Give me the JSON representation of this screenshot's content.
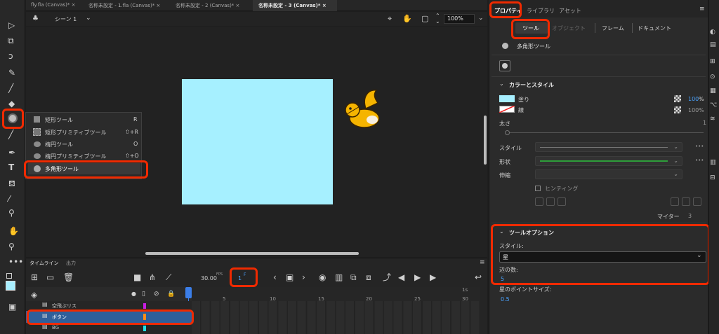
{
  "doc_tabs": [
    "fly.fla (Canvas)*",
    "名称未設定 - 1.fla (Canvas)*",
    "名称未設定 - 2 (Canvas)*",
    "名称未設定 - 3 (Canvas)*"
  ],
  "scene": {
    "name": "シーン 1",
    "zoom": "100%"
  },
  "tool_menu": [
    {
      "label": "矩形ツール",
      "key": "R"
    },
    {
      "label": "矩形プリミティブツール",
      "key": "⇧+R"
    },
    {
      "label": "楕円ツール",
      "key": "O"
    },
    {
      "label": "楕円プリミティブツール",
      "key": "⇧+O"
    },
    {
      "label": "多角形ツール",
      "key": ""
    }
  ],
  "timeline": {
    "tabs": [
      "タイムライン",
      "出力"
    ],
    "fps_value": "30.00",
    "fps_unit": "FPS",
    "frame": "1",
    "frame_unit": "F",
    "ruler": [
      "1s",
      "5",
      "10",
      "15",
      "20",
      "25",
      "30"
    ],
    "layers": [
      "空飛ぶリス",
      "ボタン",
      "BG"
    ]
  },
  "panel": {
    "tabs": [
      "プロパティ",
      "ライブラリ",
      "アセット"
    ],
    "subtabs": [
      "ツール",
      "オブジェクト",
      "フレーム",
      "ドキュメント"
    ],
    "tool_name": "多角形ツール",
    "color_style": {
      "title": "カラーとスタイル",
      "fill_label": "塗り",
      "fill_pct": "100",
      "pct_unit": "%",
      "stroke_label": "線",
      "stroke_pct": "100",
      "width_label": "太さ",
      "width_value": "1",
      "style_label": "スタイル",
      "shape_label": "形状",
      "scale_label": "伸縮",
      "hinting_label": "ヒンティング",
      "miter_label": "マイター",
      "miter_value": "3"
    },
    "tool_options": {
      "title": "ツールオプション",
      "style_label": "スタイル:",
      "style_value": "星",
      "sides_label": "辺の数:",
      "sides_value": "5",
      "point_label": "星のポイントサイズ:",
      "point_value": "0.5"
    }
  },
  "colors": {
    "fill": "#a7efff",
    "stage": "#a6f0ff",
    "highlight": "#f02a00",
    "accent": "#4aa3ff"
  }
}
